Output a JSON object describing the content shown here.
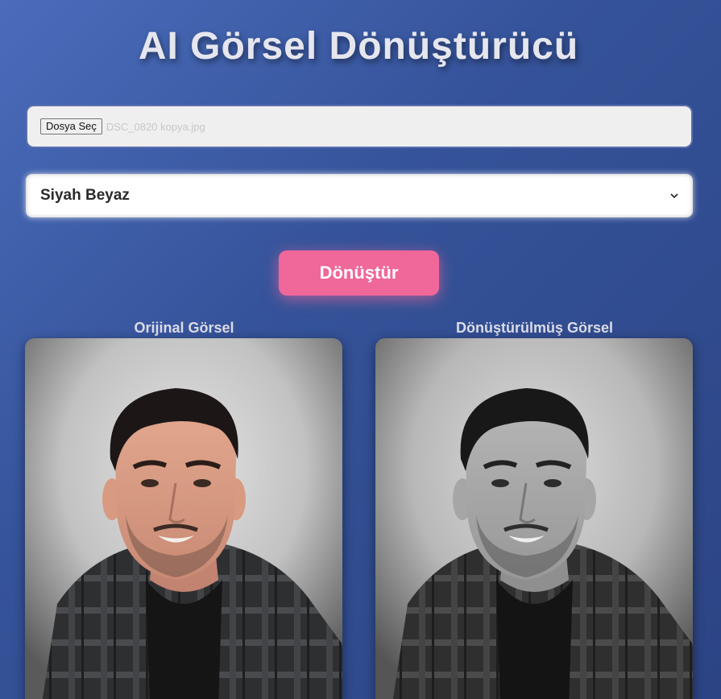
{
  "app": {
    "title": "AI Görsel Dönüştürücü"
  },
  "file_input": {
    "button_label": "Dosya Seç",
    "file_name": "DSC_0820 kopya.jpg"
  },
  "filter_select": {
    "selected": "Siyah Beyaz",
    "icon": "chevron-down-icon"
  },
  "convert_button": {
    "label": "Dönüştür",
    "color": "#f0679a"
  },
  "panels": {
    "original": {
      "title": "Orijinal Görsel"
    },
    "converted": {
      "title": "Dönüştürülmüş Görsel"
    }
  },
  "colors": {
    "background_start": "#4a6cbb",
    "background_end": "#2c4484",
    "title_text": "#e6e6ee"
  }
}
